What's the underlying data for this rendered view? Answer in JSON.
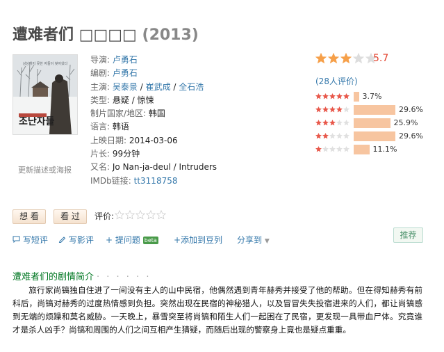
{
  "title": {
    "main": "遭难者们",
    "foreign": "□□□□",
    "year": "(2013)"
  },
  "poster": {
    "update_link": "更新描述或海报",
    "text_korean": "조난자들",
    "tagline": "상상하지 못한 자들이 찾아왔다"
  },
  "info": {
    "director": {
      "label": "导演:",
      "value": "卢勇石"
    },
    "writer": {
      "label": "编剧:",
      "value": "卢勇石"
    },
    "cast": {
      "label": "主演:",
      "values": [
        "吴泰景",
        "崔武成",
        "全石浩"
      ],
      "sep": " / "
    },
    "genre": {
      "label": "类型:",
      "value": "悬疑 / 惊悚"
    },
    "country": {
      "label": "制片国家/地区:",
      "value": "韩国"
    },
    "language": {
      "label": "语言:",
      "value": "韩语"
    },
    "release": {
      "label": "上映日期:",
      "value": "2014-03-06"
    },
    "runtime": {
      "label": "片长:",
      "value": "99分钟"
    },
    "aka": {
      "label": "又名:",
      "value": "Jo Nan-ja-deul / Intruders"
    },
    "imdb": {
      "label": "IMDb链接:",
      "value": "tt3118758"
    }
  },
  "rating": {
    "score": "5.7",
    "stars_filled": 3,
    "stars_total": 5,
    "votes": "(28人评价)",
    "distribution": [
      {
        "stars": 5,
        "percent": 3.7,
        "label": "3.7%"
      },
      {
        "stars": 4,
        "percent": 29.6,
        "label": "29.6%"
      },
      {
        "stars": 3,
        "percent": 25.9,
        "label": "25.9%"
      },
      {
        "stars": 2,
        "percent": 29.6,
        "label": "29.6%"
      },
      {
        "stars": 1,
        "percent": 11.1,
        "label": "11.1%"
      }
    ]
  },
  "buttons": {
    "want": "想 看",
    "seen": "看 过",
    "rate_label": "评价:"
  },
  "actions": {
    "short_review": "写短评",
    "review": "写影评",
    "question": "提问题",
    "beta": "beta",
    "add_doulist": "+添加到豆列",
    "share": "分享到",
    "recommend": "推荐"
  },
  "synopsis": {
    "title": "遭难者们的剧情简介",
    "dots": "· · · · · ·",
    "text": "旅行家尚镐独自住进了一间没有主人的山中民宿，他偶然遇到青年赫秀并接受了他的帮助。但在得知赫秀有前科后，尚镐对赫秀的过度热情感到负担。突然出现在民宿的神秘猎人，以及冒冒失失投宿进来的人们，都让尚镐感到无端的烦躁和莫名威胁。一天晚上，暴雪突至将尚镐和陌生人们一起困在了民宿，更发现一具带血尸体。究竟谁才是杀人凶手？尚镐和周围的人们之间互相产生猜疑，而随后出现的警察身上竟也是疑点重重。"
  },
  "colors": {
    "link": "#3377aa",
    "star": "#f6a04a",
    "star_empty": "#dddddd",
    "bar": "#f7c5a0",
    "score": "#e3422d",
    "section_title": "#007722"
  }
}
